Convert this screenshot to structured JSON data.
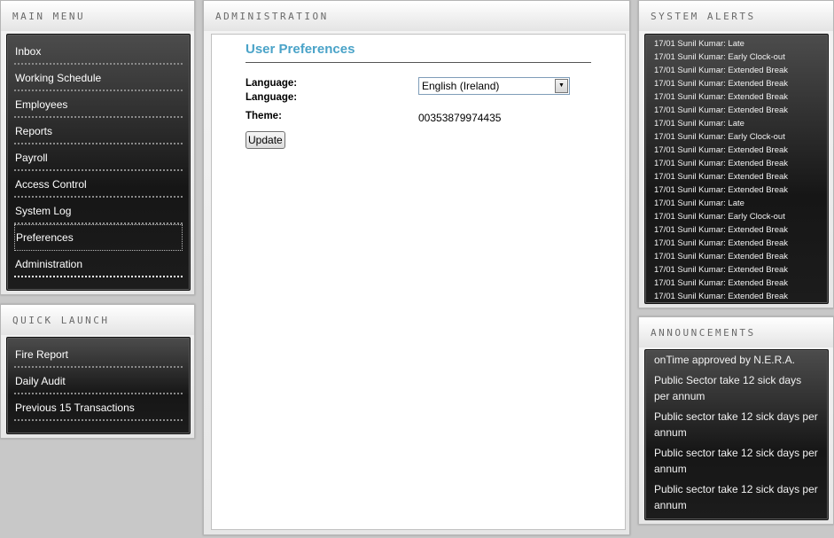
{
  "main_menu": {
    "title": "Main Menu",
    "items": [
      {
        "label": "Inbox"
      },
      {
        "label": "Working Schedule"
      },
      {
        "label": "Employees"
      },
      {
        "label": "Reports"
      },
      {
        "label": "Payroll"
      },
      {
        "label": "Access Control"
      },
      {
        "label": "System Log"
      },
      {
        "label": "Preferences"
      },
      {
        "label": "Administration"
      }
    ],
    "active_item": "Preferences"
  },
  "quick_launch": {
    "title": "Quick Launch",
    "items": [
      {
        "label": "Fire Report"
      },
      {
        "label": "Daily Audit"
      },
      {
        "label": "Previous 15 Transactions"
      }
    ]
  },
  "administration": {
    "title": "Administration",
    "heading": "User Preferences",
    "language_label_1": "Language:",
    "language_label_2": "Language:",
    "language_value": "English (Ireland)",
    "theme_label": "Theme:",
    "theme_value": "00353879974435",
    "update_label": "Update"
  },
  "system_alerts": {
    "title": "System Alerts",
    "items": [
      "17/01 Sunil Kumar: Late",
      "17/01 Sunil Kumar: Early Clock-out",
      "17/01 Sunil Kumar: Extended Break",
      "17/01 Sunil Kumar: Extended Break",
      "17/01 Sunil Kumar: Extended Break",
      "17/01 Sunil Kumar: Extended Break",
      "17/01 Sunil Kumar: Late",
      "17/01 Sunil Kumar: Early Clock-out",
      "17/01 Sunil Kumar: Extended Break",
      "17/01 Sunil Kumar: Extended Break",
      "17/01 Sunil Kumar: Extended Break",
      "17/01 Sunil Kumar: Extended Break",
      "17/01 Sunil Kumar: Late",
      "17/01 Sunil Kumar: Early Clock-out",
      "17/01 Sunil Kumar: Extended Break",
      "17/01 Sunil Kumar: Extended Break",
      "17/01 Sunil Kumar: Extended Break",
      "17/01 Sunil Kumar: Extended Break",
      "17/01 Sunil Kumar: Extended Break",
      "17/01 Sunil Kumar: Extended Break"
    ]
  },
  "announcements": {
    "title": "Announcements",
    "items": [
      "onTime approved by N.E.R.A.",
      "Public Sector take 12 sick days per annum",
      "Public sector take 12 sick days per annum",
      "Public sector take 12 sick days per annum",
      "Public sector take 12 sick days per annum"
    ]
  },
  "icons": {
    "dropdown": "chevron-down-icon"
  }
}
